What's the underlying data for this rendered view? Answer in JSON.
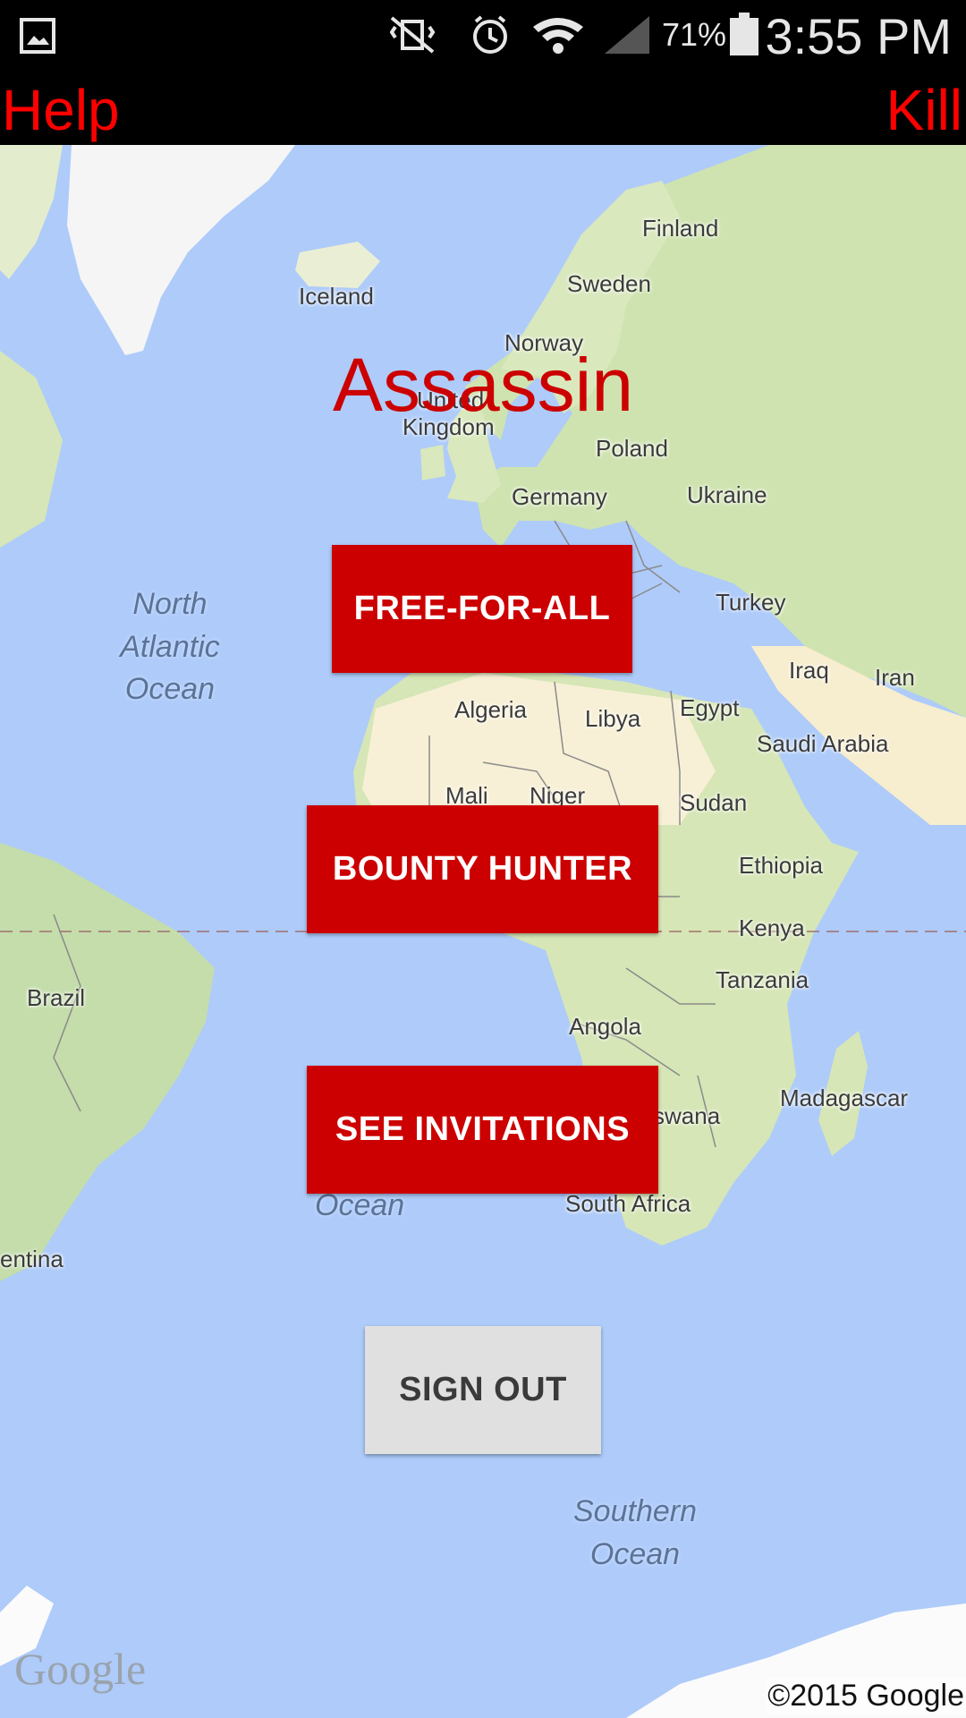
{
  "status_bar": {
    "battery": "71%",
    "time": "3:55 PM",
    "icons": [
      "gallery-icon",
      "vibrate-icon",
      "alarm-icon",
      "wifi-icon",
      "signal-icon",
      "battery-icon"
    ]
  },
  "action_bar": {
    "help_label": "Help",
    "kill_label": "Kill"
  },
  "app": {
    "title": "Assassin",
    "title_color": "#cc0000",
    "accent": "#cc0000",
    "buttons": {
      "free_for_all": "FREE-FOR-ALL",
      "bounty_hunter": "BOUNTY HUNTER",
      "see_invitations": "SEE INVITATIONS",
      "sign_out": "SIGN OUT"
    }
  },
  "map": {
    "countries": {
      "finland": "Finland",
      "iceland": "Iceland",
      "sweden": "Sweden",
      "norway": "Norway",
      "united": "United",
      "kingdom": "Kingdom",
      "poland": "Poland",
      "germany": "Germany",
      "ukraine": "Ukraine",
      "turkey": "Turkey",
      "iraq": "Iraq",
      "iran": "Iran",
      "algeria": "Algeria",
      "libya": "Libya",
      "egypt": "Egypt",
      "saudi_arabia": "Saudi Arabia",
      "mali": "Mali",
      "niger": "Niger",
      "sudan": "Sudan",
      "ethiopia": "Ethiopia",
      "kenya": "Kenya",
      "brazil": "Brazil",
      "tanzania": "Tanzania",
      "angola": "Angola",
      "madagascar": "Madagascar",
      "botswana_partial": "swana",
      "south_africa": "South Africa",
      "argentina_partial": "entina"
    },
    "oceans": {
      "north_atlantic": "North\nAtlantic\nOcean",
      "south_atlantic_partial": "Ocean",
      "southern": "Southern\nOcean"
    },
    "logo": "Google",
    "copyright": "©2015 Google"
  }
}
